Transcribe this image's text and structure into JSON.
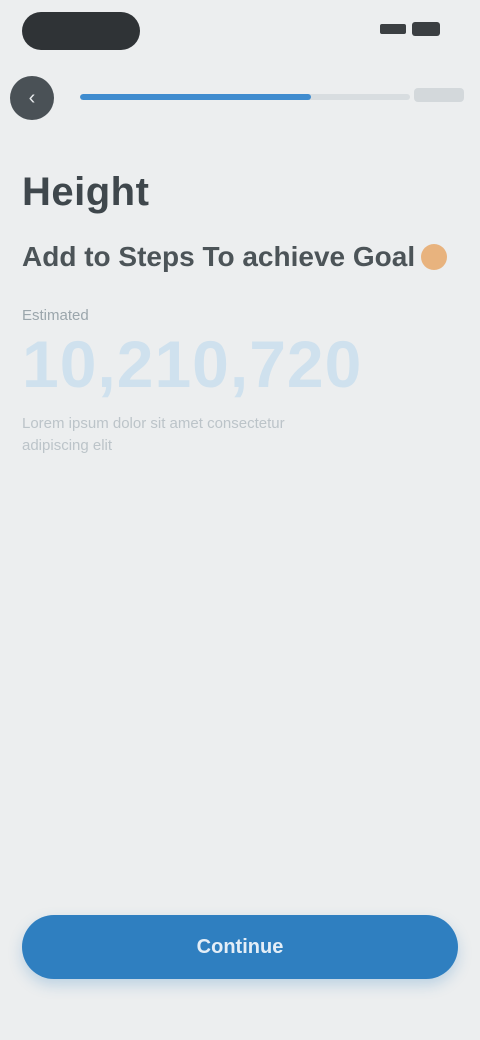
{
  "header": {
    "back_icon": "chevron-left-icon",
    "progress_fraction": 0.7,
    "accent": "#3f8ccf"
  },
  "main": {
    "title": "Height",
    "subtitle": "Add to Steps To achieve Goal",
    "label": "Estimated",
    "big_number": "10,210,720",
    "description": "Lorem ipsum dolor sit amet consectetur adipiscing elit"
  },
  "footer": {
    "button_label": "Continue",
    "button_color": "#2f7fc0"
  }
}
